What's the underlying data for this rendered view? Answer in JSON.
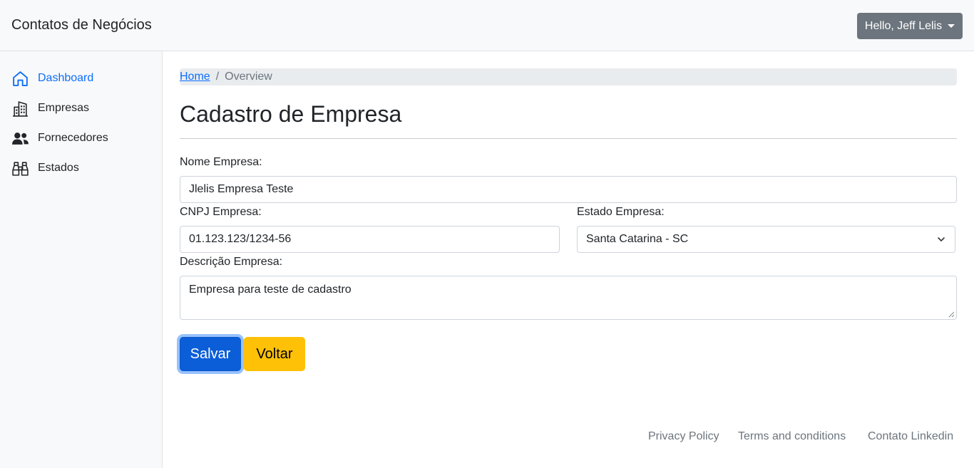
{
  "navbar": {
    "brand": "Contatos de Negócios",
    "user_label": "Hello, Jeff Lelis"
  },
  "sidebar": {
    "items": [
      {
        "label": "Dashboard",
        "icon": "home-icon",
        "active": true
      },
      {
        "label": "Empresas",
        "icon": "building-icon",
        "active": false
      },
      {
        "label": "Fornecedores",
        "icon": "people-icon",
        "active": false
      },
      {
        "label": "Estados",
        "icon": "binoculars-icon",
        "active": false
      }
    ]
  },
  "breadcrumb": {
    "home": "Home",
    "separator": "/",
    "current": "Overview"
  },
  "page": {
    "title": "Cadastro de Empresa"
  },
  "form": {
    "nome_label": "Nome Empresa:",
    "nome_value": "Jlelis Empresa Teste",
    "cnpj_label": "CNPJ Empresa:",
    "cnpj_value": "01.123.123/1234-56",
    "estado_label": "Estado Empresa:",
    "estado_value": "Santa Catarina - SC",
    "descricao_label": "Descrição Empresa:",
    "descricao_value": "Empresa para teste de cadastro",
    "save_label": "Salvar",
    "back_label": "Voltar"
  },
  "footer": {
    "links": [
      "Privacy Policy",
      "Terms and conditions",
      "Contato Linkedin"
    ]
  },
  "colors": {
    "primary": "#0d6efd",
    "warning": "#ffc107",
    "secondary": "#6c757d"
  }
}
